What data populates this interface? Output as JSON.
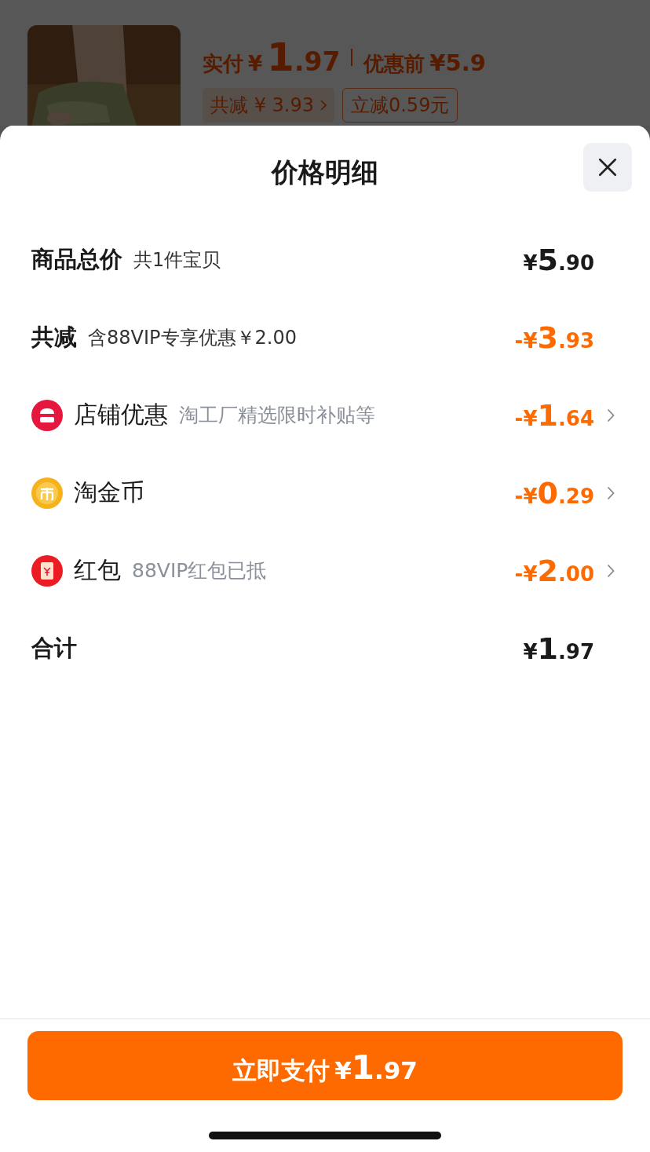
{
  "background_page": {
    "pay_label": "实付",
    "pay_price": {
      "prefix": "¥",
      "major": "1",
      "minor": ".97"
    },
    "before_label": "优惠前",
    "before_price": "¥5.9",
    "tags": [
      {
        "kind": "filled",
        "text": "共减 ¥ 3.93",
        "chevron": true
      },
      {
        "kind": "outlined",
        "text": "立减0.59元",
        "chevron": false
      }
    ]
  },
  "sheet": {
    "title": "价格明细",
    "rows": [
      {
        "kind": "summary",
        "label": "商品总价",
        "note": "共1件宝贝",
        "amount": {
          "prefix": "¥",
          "major": "5",
          "minor": ".90"
        },
        "negative": false,
        "chevron": false
      },
      {
        "kind": "summary",
        "label": "共减",
        "note": "含88VIP专享优惠￥2.00",
        "amount": {
          "prefix": "-¥",
          "major": "3",
          "minor": ".93"
        },
        "negative": true,
        "chevron": false
      },
      {
        "kind": "shop",
        "label": "店铺优惠",
        "note": "淘工厂精选限时补贴等",
        "amount": {
          "prefix": "-¥",
          "major": "1",
          "minor": ".64"
        },
        "negative": true,
        "chevron": true
      },
      {
        "kind": "coin",
        "label": "淘金币",
        "amount": {
          "prefix": "-¥",
          "major": "0",
          "minor": ".29"
        },
        "negative": true,
        "chevron": true
      },
      {
        "kind": "envelope",
        "label": "红包",
        "note": "88VIP红包已抵",
        "amount": {
          "prefix": "-¥",
          "major": "2",
          "minor": ".00"
        },
        "negative": true,
        "chevron": true
      },
      {
        "kind": "summary",
        "label": "合计",
        "amount": {
          "prefix": "¥",
          "major": "1",
          "minor": ".97"
        },
        "negative": false,
        "chevron": false
      }
    ],
    "pay_button": {
      "label": "立即支付",
      "amount": {
        "prefix": "¥",
        "major": "1",
        "minor": ".97"
      }
    }
  }
}
